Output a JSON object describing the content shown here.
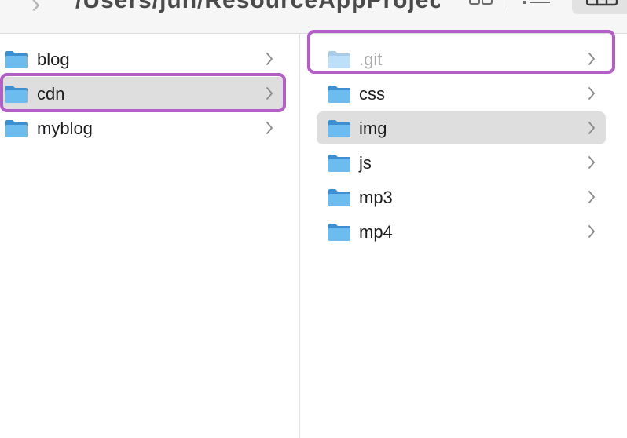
{
  "toolbar": {
    "path_text": "/Users/jun/ResourceAppProjects/..."
  },
  "column1": {
    "items": [
      {
        "label": "blog"
      },
      {
        "label": "cdn"
      },
      {
        "label": "myblog"
      }
    ]
  },
  "column2": {
    "items": [
      {
        "label": ".git"
      },
      {
        "label": "css"
      },
      {
        "label": "img"
      },
      {
        "label": "js"
      },
      {
        "label": "mp3"
      },
      {
        "label": "mp4"
      }
    ]
  },
  "colors": {
    "highlight": "#b45fc8",
    "selection": "#dedede",
    "folder": "#5fb1ea"
  },
  "icons": {
    "folder": "folder-icon",
    "chevron": "chevron-right-icon"
  }
}
